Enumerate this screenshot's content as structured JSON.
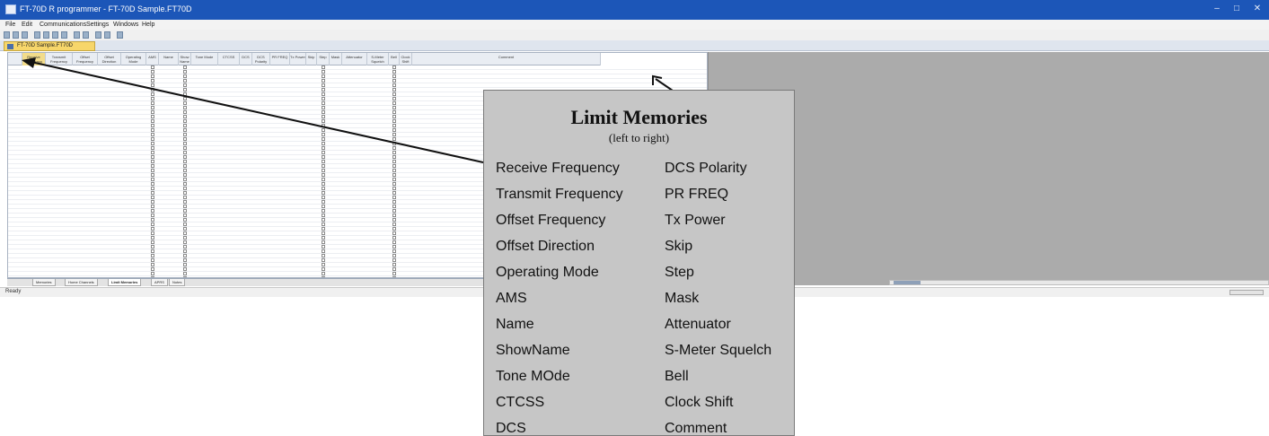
{
  "window": {
    "title": "FT-70D R programmer - FT-70D Sample.FT70D",
    "minimize": "–",
    "maximize": "□",
    "close": "✕"
  },
  "menu": [
    "File",
    "Edit",
    "Communications",
    "Settings",
    "Windows",
    "Help"
  ],
  "document_tab": "FT-70D Sample.FT70D",
  "grid": {
    "columns": [
      "Receive Frequency",
      "Transmit Frequency",
      "Offset Frequency",
      "Offset Direction",
      "Operating Mode",
      "AMS",
      "Name",
      "Show Name",
      "Tone Mode",
      "CTCSS",
      "DCS",
      "DCS Polarity",
      "PR FREQ",
      "Tx Power",
      "Skip",
      "Step",
      "Mask",
      "Attenuator",
      "S-Meter Squelch",
      "Bell",
      "Clock Shift",
      "Comment"
    ]
  },
  "sheet_tabs": [
    "Memories",
    "Home Channels",
    "Limit Memories",
    "APRS",
    "Notes"
  ],
  "status": "Ready",
  "callout": {
    "title": "Limit Memories",
    "subtitle": "(left to right)",
    "left_items": [
      "Receive Frequency",
      "Transmit Frequency",
      "Offset Frequency",
      "Offset Direction",
      "Operating Mode",
      "AMS",
      "Name",
      "ShowName",
      "Tone MOde",
      "CTCSS",
      "DCS"
    ],
    "right_items": [
      "DCS Polarity",
      "PR FREQ",
      "Tx Power",
      "Skip",
      "Step",
      "Mask",
      "Attenuator",
      "S-Meter Squelch",
      "Bell",
      "Clock Shift",
      "Comment"
    ]
  },
  "colors": {
    "titlebar": "#1c56b8",
    "selected_header": "#f2dc8a",
    "callout_bg": "#c6c6c6",
    "pane_gray": "#ababab"
  }
}
